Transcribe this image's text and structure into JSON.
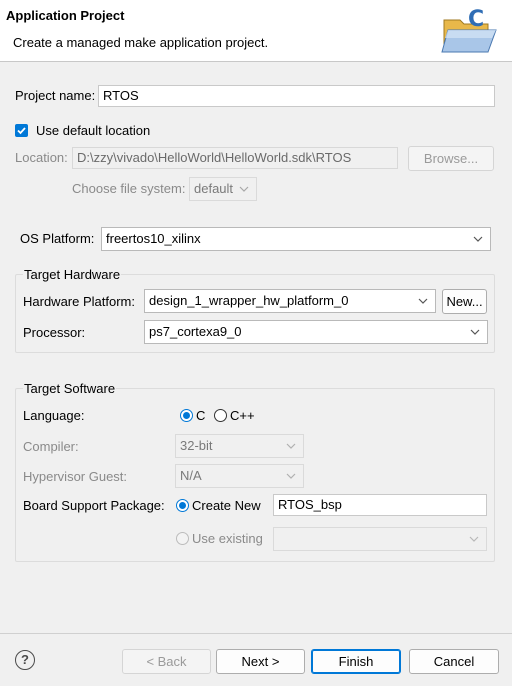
{
  "header": {
    "title": "Application Project",
    "description": "Create a managed make application project.",
    "banner_icon": "folder-c-icon"
  },
  "project": {
    "name_label": "Project name:",
    "name_value": "RTOS",
    "use_default_location_label": "Use default location",
    "use_default_location_checked": true,
    "location_label": "Location:",
    "location_value": "D:\\zzy\\vivado\\HelloWorld\\HelloWorld.sdk\\RTOS",
    "browse_label": "Browse...",
    "file_system_label": "Choose file system:",
    "file_system_value": "default"
  },
  "os_platform": {
    "label": "OS Platform:",
    "value": "freertos10_xilinx"
  },
  "target_hardware": {
    "title": "Target Hardware",
    "hw_platform_label": "Hardware Platform:",
    "hw_platform_value": "design_1_wrapper_hw_platform_0",
    "new_label": "New...",
    "processor_label": "Processor:",
    "processor_value": "ps7_cortexa9_0"
  },
  "target_software": {
    "title": "Target Software",
    "language_label": "Language:",
    "lang_c": "C",
    "lang_cpp": "C++",
    "selected_language": "C",
    "compiler_label": "Compiler:",
    "compiler_value": "32-bit",
    "hypervisor_label": "Hypervisor Guest:",
    "hypervisor_value": "N/A",
    "bsp_label": "Board Support Package:",
    "create_new_label": "Create New",
    "create_new_value": "RTOS_bsp",
    "use_existing_label": "Use existing",
    "use_existing_value": ""
  },
  "footer": {
    "help_glyph": "?",
    "back_label": "< Back",
    "next_label": "Next >",
    "finish_label": "Finish",
    "cancel_label": "Cancel"
  },
  "colors": {
    "accent": "#0078d7",
    "header_bg": "#ffffff",
    "dialog_bg": "#f0f0f0"
  }
}
